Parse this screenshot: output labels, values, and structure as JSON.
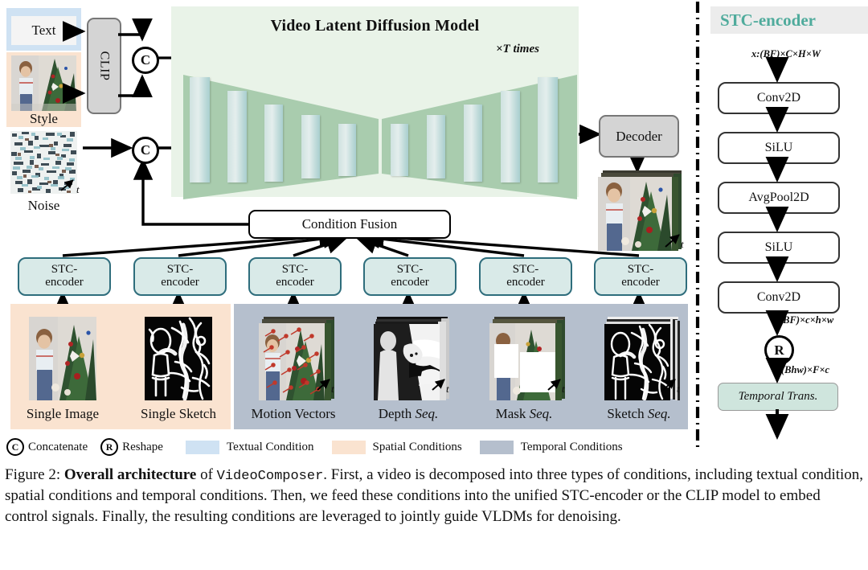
{
  "inputs": {
    "text_label": "Text",
    "style_label": "Style",
    "noise_label": "Noise",
    "clip_label": "CLIP",
    "time_axis": "t"
  },
  "vldm": {
    "title": "Video Latent Diffusion Model",
    "repeat_label": "×T times",
    "decoder_label": "Decoder",
    "condition_fusion_label": "Condition Fusion",
    "concat_symbol": "C"
  },
  "stc_encoders": [
    {
      "line1": "STC-",
      "line2": "encoder"
    },
    {
      "line1": "STC-",
      "line2": "encoder"
    },
    {
      "line1": "STC-",
      "line2": "encoder"
    },
    {
      "line1": "STC-",
      "line2": "encoder"
    },
    {
      "line1": "STC-",
      "line2": "encoder"
    },
    {
      "line1": "STC-",
      "line2": "encoder"
    }
  ],
  "conditions": {
    "spatial": [
      {
        "label": "Single Image",
        "kind": "photo"
      },
      {
        "label": "Single Sketch",
        "kind": "sketch"
      }
    ],
    "temporal": [
      {
        "label_main": "Motion Vectors",
        "label_it": "",
        "kind": "motion"
      },
      {
        "label_main": "Depth ",
        "label_it": "Seq.",
        "kind": "depth"
      },
      {
        "label_main": "Mask ",
        "label_it": "Seq.",
        "kind": "mask"
      },
      {
        "label_main": "Sketch ",
        "label_it": "Seq.",
        "kind": "sketchseq"
      }
    ]
  },
  "legend": {
    "concatenate_symbol": "C",
    "concatenate_label": "Concatenate",
    "reshape_symbol": "R",
    "reshape_label": "Reshape",
    "items": [
      {
        "label": "Textual Condition",
        "color": "#cfe2f3"
      },
      {
        "label": "Spatial Conditions",
        "color": "#fae3d0"
      },
      {
        "label": "Temporal Conditions",
        "color": "#b5bfcd"
      }
    ]
  },
  "stc_panel": {
    "title": "STC-encoder",
    "input_shape": "x:(BF)×C×H×W",
    "blocks": [
      "Conv2D",
      "SiLU",
      "AvgPool2D",
      "SiLU",
      "Conv2D"
    ],
    "mid_shape": "(BF)×c×h×w",
    "reshape_symbol": "R",
    "out_shape": "(Bhw)×F×c",
    "temporal_trans_label": "Temporal Trans."
  },
  "caption": {
    "fig_no": "Figure 2:",
    "bold": "Overall architecture",
    "of": " of ",
    "mono": "VideoComposer",
    "rest": ". First, a video is decomposed into three types of conditions, including textual condition, spatial conditions and temporal conditions. Then, we feed these conditions into the unified STC-encoder or the CLIP model to embed control signals. Finally, the resulting conditions are leveraged to jointly guide VLDMs for denoising."
  },
  "colors": {
    "textual": "#cfe2f3",
    "spatial": "#fae3d0",
    "temporal": "#b5bfcd",
    "vldm_panel": "#e9f3e8",
    "trapezoid": "#a9ccae",
    "stc_fill": "#d9eae8",
    "stc_title": "#4fab9c"
  }
}
